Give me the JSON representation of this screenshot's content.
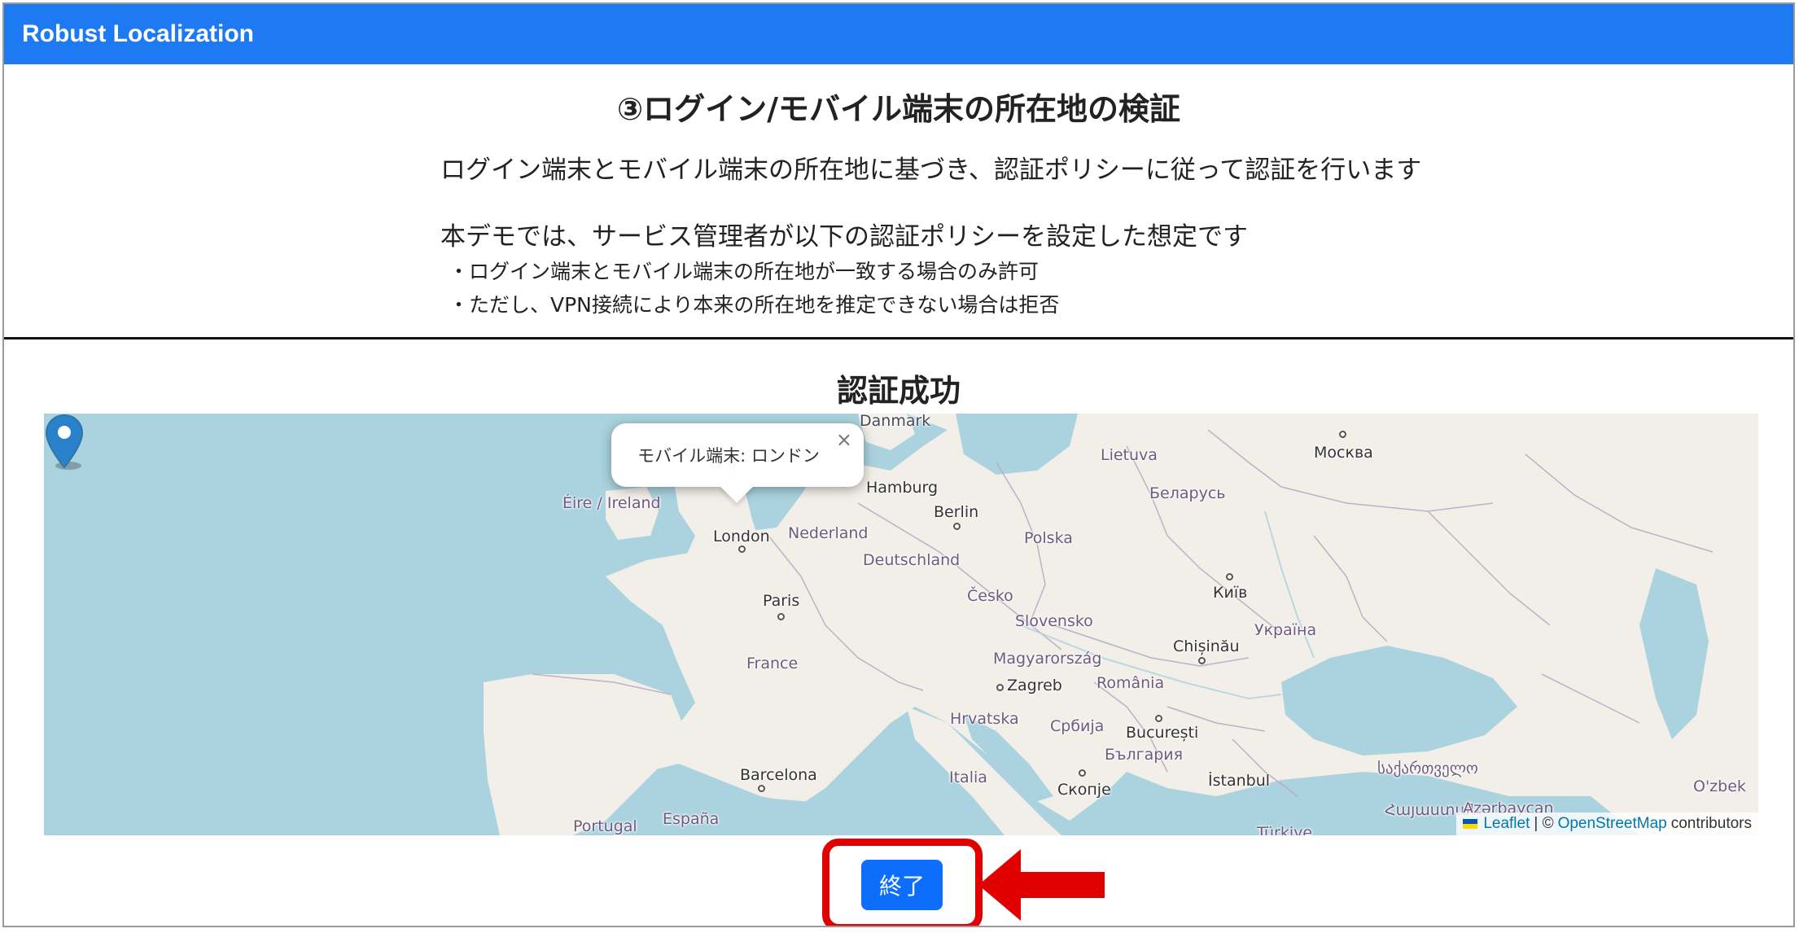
{
  "navbar": {
    "brand": "Robust Localization"
  },
  "step": {
    "title": "③ログイン/モバイル端末の所在地の検証",
    "description": "ログイン端末とモバイル端末の所在地に基づき、認証ポリシーに従って認証を行います",
    "policy_intro": "本デモでは、サービス管理者が以下の認証ポリシーを設定した想定です",
    "policy_items": [
      "・ログイン端末とモバイル端末の所在地が一致する場合のみ許可",
      "・ただし、VPN接続により本来の所在地を推定できない場合は拒否"
    ]
  },
  "result": {
    "title": "認証成功"
  },
  "map": {
    "popup_text": "モバイル端末: ロンドン",
    "popup_close": "×",
    "labels": {
      "danmark": "Danmark",
      "lietuva": "Lietuva",
      "moskva": "Москва",
      "eire": "Éire / Ireland",
      "hamburg": "Hamburg",
      "berlin": "Berlin",
      "belarus": "Беларусь",
      "london": "London",
      "nederland": "Nederland",
      "polska": "Polska",
      "deutschland": "Deutschland",
      "kyiv": "Київ",
      "paris": "Paris",
      "cesko": "Česko",
      "slovensko": "Slovensko",
      "chisinau": "Chișinău",
      "ukraina": "Україна",
      "france": "France",
      "magyarorszag": "Magyarország",
      "zagreb": "Zagreb",
      "romania": "România",
      "hrvatska": "Hrvatska",
      "srbija": "Србија",
      "bucuresti": "București",
      "bulgaria": "България",
      "barcelona": "Barcelona",
      "italia": "Italia",
      "skopje": "Скопје",
      "istanbul": "İstanbul",
      "sakartvelo": "საქართველო",
      "ozbek": "O'zbek",
      "portugal": "Portugal",
      "espana": "España",
      "hayastan": "Հայաստան",
      "azarbaycan": "Azərbaycan",
      "turkiye": "Türkiye"
    },
    "attribution": {
      "leaflet": "Leaflet",
      "separator": "| ©",
      "osm": "OpenStreetMap",
      "contributors": "contributors"
    }
  },
  "actions": {
    "finish_label": "終了"
  },
  "colors": {
    "navbar": "#1d7af3",
    "button": "#0d6efd",
    "highlight": "#e00000",
    "sea": "#aad3df",
    "land": "#f2efe9"
  }
}
